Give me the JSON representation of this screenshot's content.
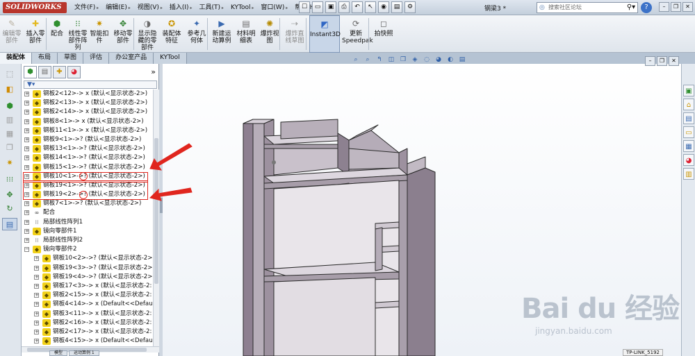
{
  "app": {
    "logo": "SOLIDWORKS",
    "doc_title": "钢梁3 *"
  },
  "menu": [
    "文件(F)",
    "编辑(E)",
    "视图(V)",
    "插入(I)",
    "工具(T)",
    "KYTool",
    "窗口(W)",
    "帮助(H)"
  ],
  "search": {
    "placeholder": "搜索社区论坛",
    "button": "⚲▾"
  },
  "commands": [
    {
      "label": "编辑零\n部件",
      "icon": "edit-component-icon",
      "enabled": false
    },
    {
      "label": "插入零\n部件",
      "icon": "insert-component-icon",
      "enabled": true
    },
    {
      "label": "配合",
      "icon": "mate-icon",
      "enabled": true
    },
    {
      "label": "线性零\n部件阵\n列",
      "icon": "linear-pattern-icon",
      "enabled": true
    },
    {
      "label": "智能扣\n件",
      "icon": "smart-fastener-icon",
      "enabled": true
    },
    {
      "label": "移动零\n部件",
      "icon": "move-component-icon",
      "enabled": true
    },
    {
      "label": "显示隐\n藏的零\n部件",
      "icon": "show-hidden-icon",
      "enabled": true
    },
    {
      "label": "装配体\n特征",
      "icon": "assembly-feature-icon",
      "enabled": true
    },
    {
      "label": "参考几\n何体",
      "icon": "reference-geometry-icon",
      "enabled": true
    },
    {
      "label": "新建运\n动算例",
      "icon": "motion-study-icon",
      "enabled": true
    },
    {
      "label": "材料明\n细表",
      "icon": "bom-icon",
      "enabled": true
    },
    {
      "label": "爆炸视\n图",
      "icon": "exploded-view-icon",
      "enabled": true
    },
    {
      "label": "爆炸直\n线草图",
      "icon": "explode-line-icon",
      "enabled": false
    },
    {
      "label": "Instant3D",
      "icon": "instant3d-icon",
      "enabled": true,
      "active": true
    },
    {
      "label": "更新\nSpeedpak",
      "icon": "speedpak-icon",
      "enabled": true
    },
    {
      "label": "拍快照",
      "icon": "snapshot-icon",
      "enabled": true
    }
  ],
  "tabs": [
    "装配体",
    "布局",
    "草图",
    "评估",
    "办公室产品",
    "KYTool"
  ],
  "active_tab": "装配体",
  "tree": [
    {
      "type": "part",
      "label": "钢板2<12>-> x (默认<显示状态-2>)"
    },
    {
      "type": "part",
      "label": "钢板2<13>-> x (默认<显示状态-2>)"
    },
    {
      "type": "part",
      "label": "钢板2<14>-> x (默认<显示状态-2>)"
    },
    {
      "type": "part",
      "label": "钢板8<1>-> x (默认<显示状态-2>)"
    },
    {
      "type": "part",
      "label": "钢板11<1>-> x (默认<显示状态-2>)"
    },
    {
      "type": "part",
      "label": "钢板9<1>->? (默认<显示状态-2>)"
    },
    {
      "type": "part",
      "label": "钢板13<1>->? (默认<显示状态-2>)"
    },
    {
      "type": "part",
      "label": "钢板14<1>->? (默认<显示状态-2>)"
    },
    {
      "type": "part",
      "label": "钢板15<1>->? (默认<显示状态-2>)"
    },
    {
      "type": "part",
      "label": "钢板10<1>->? (默认<显示状态-2>)",
      "highlight": true
    },
    {
      "type": "part",
      "label": "钢板19<1>->? (默认<显示状态-2>)"
    },
    {
      "type": "part",
      "label": "钢板19<2>->? (默认<显示状态-2>)",
      "highlight": true
    },
    {
      "type": "part",
      "label": "钢板7<1>->? (默认<显示状态-2>)"
    },
    {
      "type": "mate",
      "label": "配合"
    },
    {
      "type": "pat",
      "label": "局部线性阵列1"
    },
    {
      "type": "mir",
      "label": "镜向零部件1"
    },
    {
      "type": "pat",
      "label": "局部线性阵列2"
    },
    {
      "type": "mir",
      "label": "镜向零部件2",
      "expanded": true
    },
    {
      "type": "part",
      "label": "钢板10<2>->? (默认<显示状态-2>",
      "child": true
    },
    {
      "type": "part",
      "label": "钢板19<3>->? (默认<显示状态-2>",
      "child": true
    },
    {
      "type": "part",
      "label": "钢板19<4>->? (默认<显示状态-2>",
      "child": true
    },
    {
      "type": "part",
      "label": "钢板17<3>-> x (默认<显示状态-2:",
      "child": true
    },
    {
      "type": "part",
      "label": "钢板2<15>-> x (默认<显示状态-2:",
      "child": true
    },
    {
      "type": "part",
      "label": "钢板4<14>-> x (Default<<Defaul",
      "child": true
    },
    {
      "type": "part",
      "label": "钢板3<11>-> x (默认<显示状态-2:",
      "child": true
    },
    {
      "type": "part",
      "label": "钢板2<16>-> x (默认<显示状态-2:",
      "child": true
    },
    {
      "type": "part",
      "label": "钢板2<17>-> x (默认<显示状态-2:",
      "child": true
    },
    {
      "type": "part",
      "label": "钢板4<15>-> x (Default<<Defaul",
      "child": true
    }
  ],
  "bottom_tabs": [
    "模型",
    "运动算例 1"
  ],
  "status_chip": "TP-LINK_5192",
  "watermark": {
    "main": "Bai du 经验",
    "sub": "jingyan.baidu.com"
  },
  "colors": {
    "accent": "#e0261e",
    "part_icon": "#f1d11a",
    "model_face": "#b4abb6"
  }
}
